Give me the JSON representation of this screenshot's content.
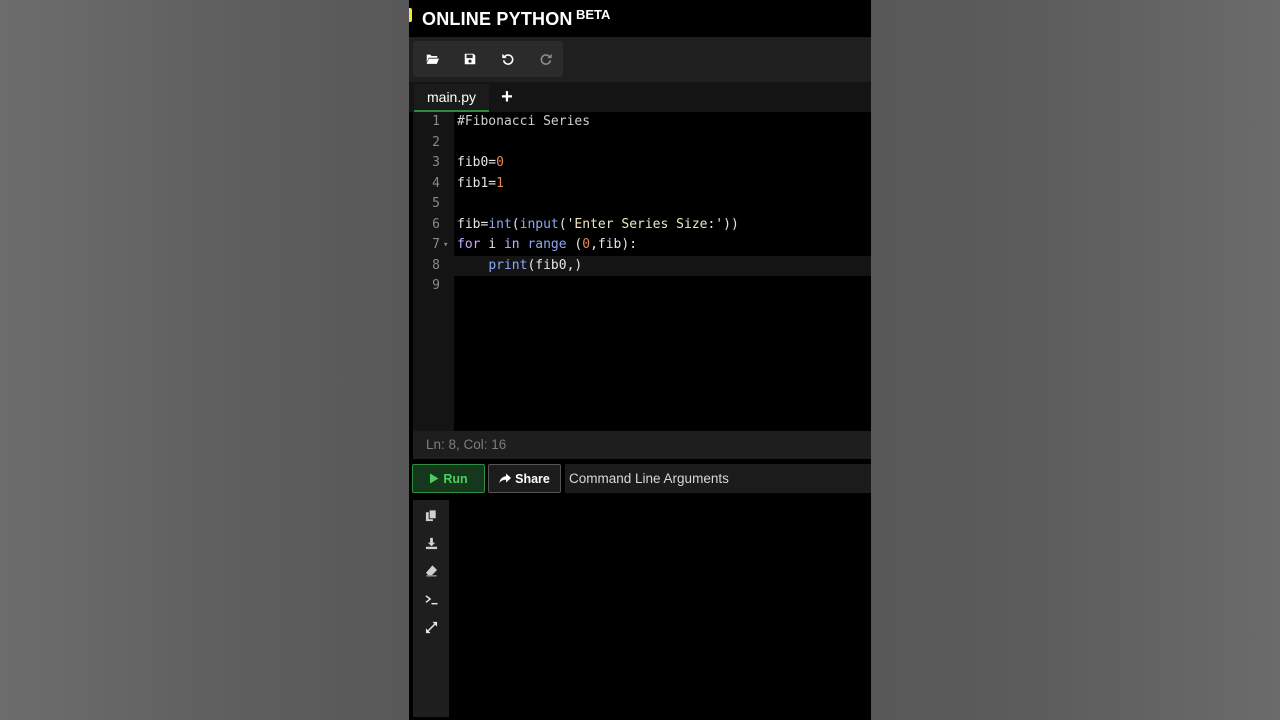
{
  "app": {
    "brand": "ONLINE PYTHON",
    "brand_tag": "BETA"
  },
  "toolbar": {
    "icons": [
      "folder-open-icon",
      "save-icon",
      "undo-icon",
      "redo-icon"
    ]
  },
  "tabs": {
    "file_name": "main.py",
    "add_label": "+"
  },
  "editor": {
    "lines": [
      {
        "n": "1",
        "text": "#Fibonacci Series"
      },
      {
        "n": "2",
        "text": ""
      },
      {
        "n": "3",
        "text": "fib0=0"
      },
      {
        "n": "4",
        "text": "fib1=1"
      },
      {
        "n": "5",
        "text": ""
      },
      {
        "n": "6",
        "text": "fib=int(input('Enter Series Size:'))"
      },
      {
        "n": "7",
        "text": "for i in range (0,fib):"
      },
      {
        "n": "8",
        "text": "    print(fib0,)"
      },
      {
        "n": "9",
        "text": ""
      }
    ],
    "active_line": 8
  },
  "status": {
    "position": "Ln: 8,  Col: 16"
  },
  "run_bar": {
    "run_label": "Run",
    "share_label": "Share",
    "args_placeholder": "Command Line Arguments"
  },
  "console": {
    "icons": [
      "copy-icon",
      "download-icon",
      "eraser-icon",
      "terminal-icon",
      "expand-icon"
    ]
  },
  "colors": {
    "accent_green": "#2a8c3c",
    "run_text": "#4ccf5f",
    "number": "#e88a4f",
    "keyword": "#c9a8ff",
    "function": "#8fa8f5"
  }
}
